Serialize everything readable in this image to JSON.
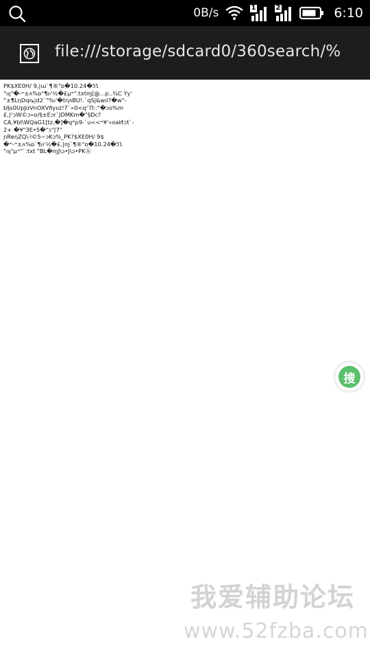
{
  "status_bar": {
    "net_speed": "0B/s",
    "sim1_label": "1",
    "sim2_label": "2",
    "time": "6:10",
    "icons": [
      "search-icon",
      "wifi-icon",
      "signal-sim1-icon",
      "signal-sim2-icon",
      "battery-icon"
    ]
  },
  "urlbar": {
    "url": "file:///storage/sdcard0/360search/%",
    "icon": "globe-icon"
  },
  "page": {
    "content_lines": [
      "PK$XE0H/ 9,|ɯ`¶®\"ɒ�10.24�ɔ̃ɿ̃",
      "\"ııȷ\"�-⁼±ʌ%ɒ\"¶ıı'½�£μ⁼\":txtɱ[@...p..¾C Yy'",
      "\"±¶LηDqȵ|d2`\"%ı'�tɳʌBU!.`qSj&wıl?�w\"-",
      "b§s0UpͿɑVnOXVπ̃yıız!7`»0<qʳ ́Π::\"�ɔo%m",
      "£,|ᶜɔW©ɔ»ɒ/§±Eɔr`JDMKm�\"§Dc?",
      "CA,¥bl\\WQaG1[tz,�]�qʷp9-`u<<⁼¥'«oal⁄tɔt`-",
      "2+ �¥\"3E•5�\"ɔ\"ʃ7\"",
      "ɲReηZQ\\·l©5~ɔKɔ%_PK?$XE0H/ 9$",
      "�⁼-⁼±ʌ%ɒ`¶ıı'½�£,|ɱ`¶®\"ɒ�10.24�ɔ̃ɿ̃",
      "\"ııȷ\"μ⁼\"`:txt \"BL�ɱJ\\ɔ•J\\ɔ•PKⓑ"
    ]
  },
  "float_button": {
    "label": "搜"
  },
  "watermark": {
    "title": "我爱辅助论坛",
    "url": "www.52fzba.com"
  }
}
